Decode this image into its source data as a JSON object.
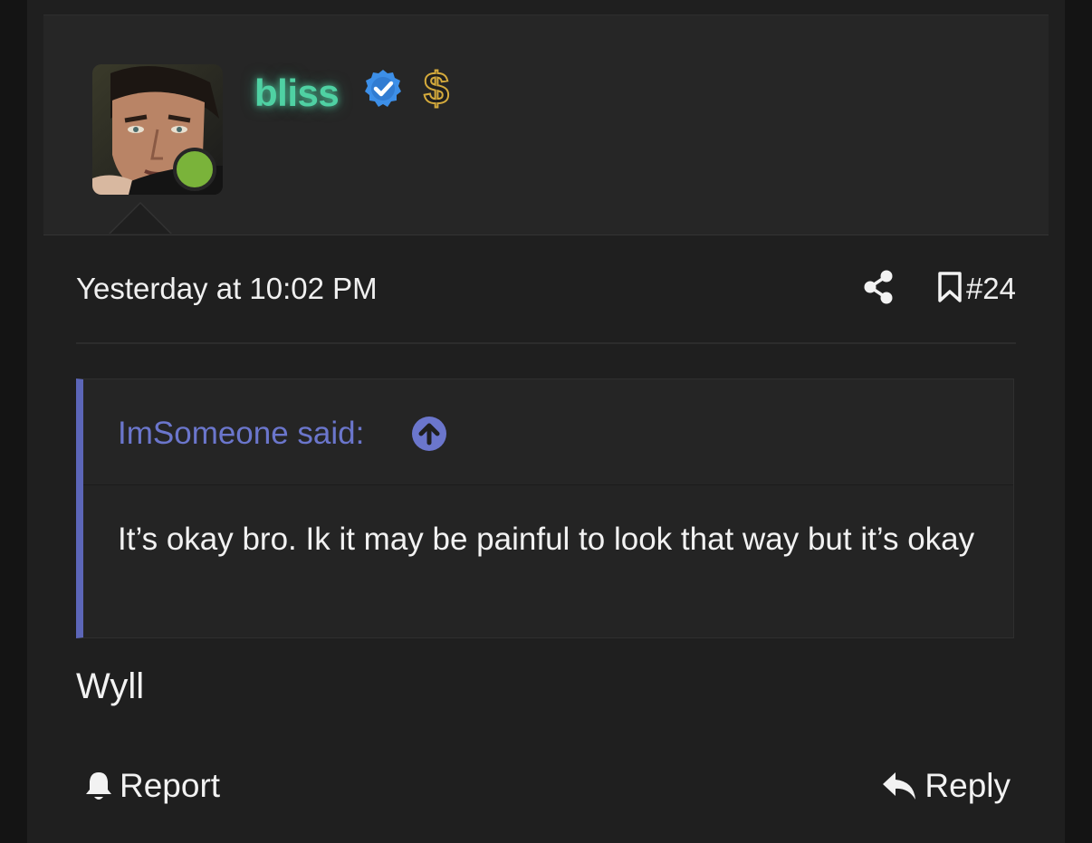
{
  "post": {
    "username": "bliss",
    "timestamp": "Yesterday at 10:02 PM",
    "post_number": "#24",
    "text": "Wyll",
    "icons": {
      "verified": "verified-check-icon",
      "badge": "dollar-badge-icon",
      "share": "share-icon",
      "bookmark": "bookmark-icon",
      "status": "online-status-dot"
    },
    "colors": {
      "username": "#4fd1a3",
      "verified": "#3d8fe8",
      "dollar": "#d4aa3c",
      "online": "#7ab33a",
      "quote_accent": "#5c66b8"
    }
  },
  "quote": {
    "author": "ImSomeone said:",
    "text": "It’s okay bro. Ik it may be painful to look that way but it’s okay",
    "icon": "expand-quote-icon"
  },
  "actions": {
    "report_label": "Report",
    "reply_label": "Reply",
    "report_icon": "bell-icon",
    "reply_icon": "reply-arrow-icon"
  }
}
